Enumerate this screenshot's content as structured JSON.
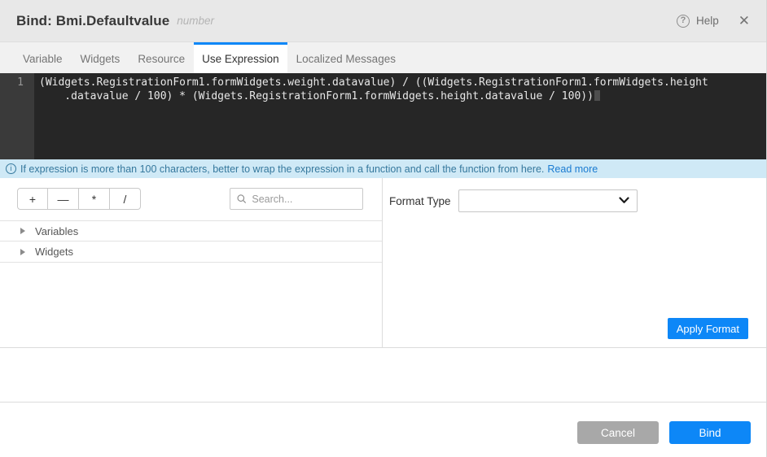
{
  "header": {
    "title": "Bind: Bmi.Defaultvalue",
    "subtitle": "number",
    "help_label": "Help"
  },
  "tabs": [
    {
      "label": "Variable"
    },
    {
      "label": "Widgets"
    },
    {
      "label": "Resource"
    },
    {
      "label": "Use Expression",
      "active": true
    },
    {
      "label": "Localized Messages"
    }
  ],
  "editor": {
    "line_number": "1",
    "lines": [
      "(Widgets.RegistrationForm1.formWidgets.weight.datavalue) / ((Widgets.RegistrationForm1.formWidgets.height",
      "    .datavalue / 100) * (Widgets.RegistrationForm1.formWidgets.height.datavalue / 100))"
    ]
  },
  "info_bar": {
    "icon": "i",
    "message": "If expression is more than 100 characters, better to wrap the expression in a function and call the function from here.",
    "link_label": "Read more"
  },
  "left_panel": {
    "operators": [
      "+",
      "—",
      "*",
      "/"
    ],
    "search_placeholder": "Search...",
    "tree_items": [
      "Variables",
      "Widgets"
    ]
  },
  "right_panel": {
    "format_type_label": "Format Type",
    "format_type_value": "",
    "apply_button_label": "Apply Format"
  },
  "footer": {
    "cancel_label": "Cancel",
    "bind_label": "Bind"
  },
  "colors": {
    "accent_blue": "#0d87f7",
    "info_bar_bg": "#cfe9f6",
    "info_bar_text": "#35789d",
    "link_blue": "#1a7bd1",
    "editor_bg": "#262626",
    "editor_gutter_bg": "#3a3a3a",
    "cancel_gray": "#a8a8a8"
  }
}
